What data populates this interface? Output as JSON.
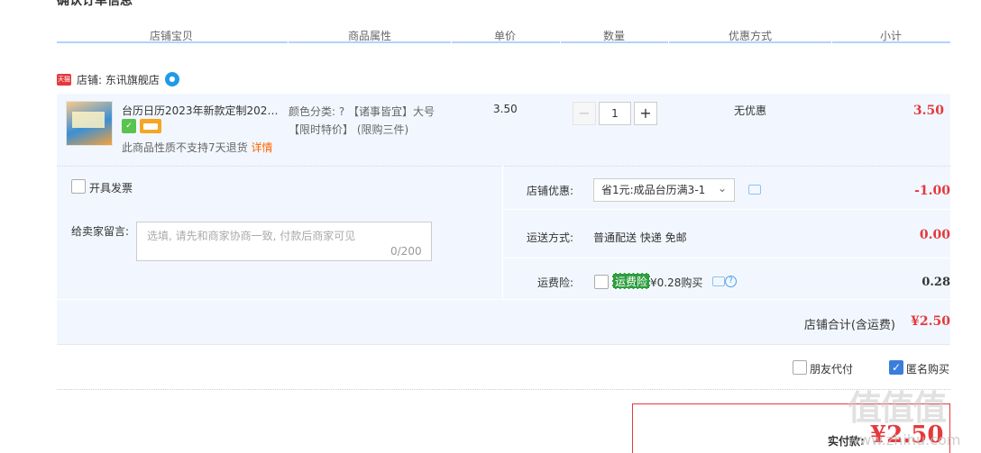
{
  "section_title": "确认订单信息",
  "columns": [
    "店铺宝贝",
    "商品属性",
    "单价",
    "数量",
    "优惠方式",
    "小计"
  ],
  "shop": {
    "badge": "天猫",
    "label": "店铺: 东讯旗舰店",
    "ww_icon": "wangwang-icon"
  },
  "item": {
    "title": "台历日历2023年新款定制2022...",
    "no_return": "此商品性质不支持7天退货",
    "detail_link": "详情",
    "attr_line1": "颜色分类: ? 【诸事皆宜】大号",
    "attr_line2": "【限时特价】 (限购三件)",
    "price": "3.50",
    "qty_minus": "−",
    "qty": "1",
    "qty_plus": "+",
    "promo": "无优惠",
    "subtotal": "3.50"
  },
  "invoice": {
    "label": "开具发票",
    "checked": false
  },
  "message": {
    "label": "给卖家留言:",
    "placeholder": "选填, 请先和商家协商一致, 付款后商家可见",
    "count": "0/200"
  },
  "shop_coupon": {
    "label": "店铺优惠:",
    "selected": "省1元:成品台历满3-1",
    "value": "-1.00"
  },
  "shipping": {
    "label": "运送方式:",
    "text": "普通配送 快递 免邮",
    "value": "0.00"
  },
  "insurance": {
    "label": "运费险:",
    "badge": "运费险",
    "text": "¥0.28购买",
    "value": "0.28",
    "checked": false
  },
  "shop_total": {
    "label": "店铺合计(含运费)",
    "value": "¥2.50"
  },
  "options": {
    "friend_pay": {
      "label": "朋友代付",
      "checked": false
    },
    "anonymous": {
      "label": "匿名购买",
      "checked": true
    }
  },
  "pay": {
    "label": "实付款:",
    "value": "¥2.50"
  },
  "watermark": {
    "logo": "值值值",
    "text": "www.zhihu.com"
  },
  "colors": {
    "accent_red": "#e4393c",
    "header_line": "#b2d1ff",
    "panel_bg": "#f2f7ff",
    "check_blue": "#3b7ddd"
  }
}
